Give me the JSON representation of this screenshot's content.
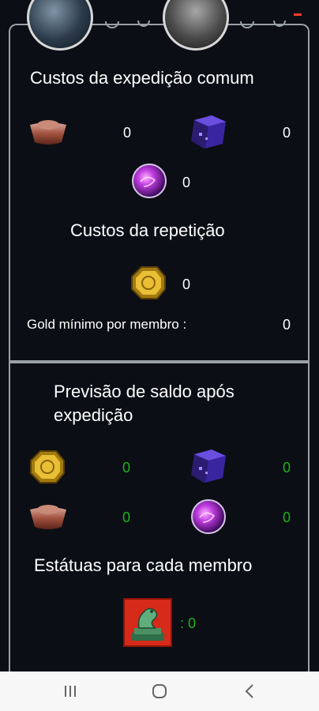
{
  "costs": {
    "title": "Custos da expedição comum",
    "silver_ingot": "0",
    "purple_cube": "0",
    "purple_orb": "0"
  },
  "repeat": {
    "title": "Custos da repetição",
    "gold_coin": "0",
    "min_gold_label": "Gold mínimo por membro :",
    "min_gold_value": "0"
  },
  "forecast": {
    "title": "Previsão de saldo após expedição",
    "gold_coin": "0",
    "purple_cube": "0",
    "silver_ingot": "0",
    "purple_orb": "0"
  },
  "statues": {
    "title": "Estátuas para cada membro",
    "value": ": 0"
  },
  "colors": {
    "background": "#0b0e15",
    "border": "#9aa0a8",
    "positive": "#1bb31b",
    "status_accent": "#ff3b2f"
  },
  "navbar": {
    "recents": "recents-icon",
    "home": "home-icon",
    "back": "back-icon"
  }
}
